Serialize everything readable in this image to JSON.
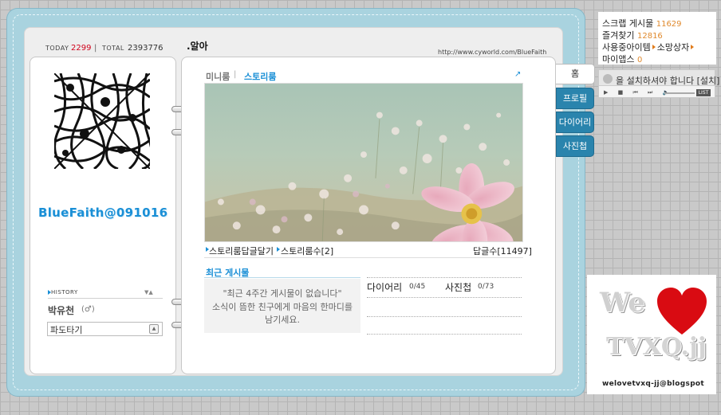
{
  "header": {
    "today_label": "TODAY",
    "today_count": "2299",
    "separator": "|",
    "total_label": "TOTAL",
    "total_count": "2393776",
    "title": ".알아",
    "url": "http://www.cyworld.com/BlueFaith"
  },
  "profile": {
    "nickname": "BlueFaith@091016",
    "history_label": "HISTORY",
    "history_arrows": "▼▲",
    "owner_name": "박유천",
    "owner_gender": "(♂)",
    "surf_label": "파도타기",
    "surf_button": "▲"
  },
  "content": {
    "tab_miniroom": "미니룸",
    "tab_separator": "|",
    "tab_storyroom": "스토리룸",
    "tab_corner": "↗",
    "link_reply": "스토리룸답글달기",
    "link_count": "스토리룸수[2]",
    "reply_count": "답글수[11497]",
    "recent_title": "최근 게시물",
    "recent_msg_line1": "\"최근 4주간 게시물이 없습니다\"",
    "recent_msg_line2": "소식이 뜸한 친구에게 마음의 한마디를",
    "recent_msg_line3": "남기세요.",
    "diary_label": "다이어리",
    "diary_value": "0/45",
    "photo_label": "사진첩",
    "photo_value": "0/73"
  },
  "side_tabs": {
    "home": "홈",
    "profile": "프로필",
    "diary": "다이어리",
    "album": "사진첩"
  },
  "info": {
    "scrap_label": "스크랩 게시물",
    "scrap_value": "11629",
    "fav_label": "즐겨찾기",
    "fav_value": "12816",
    "items_label": "사용중아이템",
    "wish_label": "소망상자",
    "myapps_label": "마이앱스",
    "myapps_value": "0"
  },
  "player": {
    "notice": "을 설치하셔야 합니다 [설치]",
    "controls": "▶ ■ ⏮ ⏭ 🔈",
    "list_label": "LIST"
  },
  "banner": {
    "we": "We",
    "tvxq": "TVXQ.jj",
    "email": "welovetvxq-jj@blogspot"
  },
  "colors": {
    "frame": "#a9d3df",
    "accent_blue": "#1a8fd6",
    "tab_blue": "#2a84ad",
    "today_red": "#d0021b",
    "info_orange": "#e08a2e"
  }
}
